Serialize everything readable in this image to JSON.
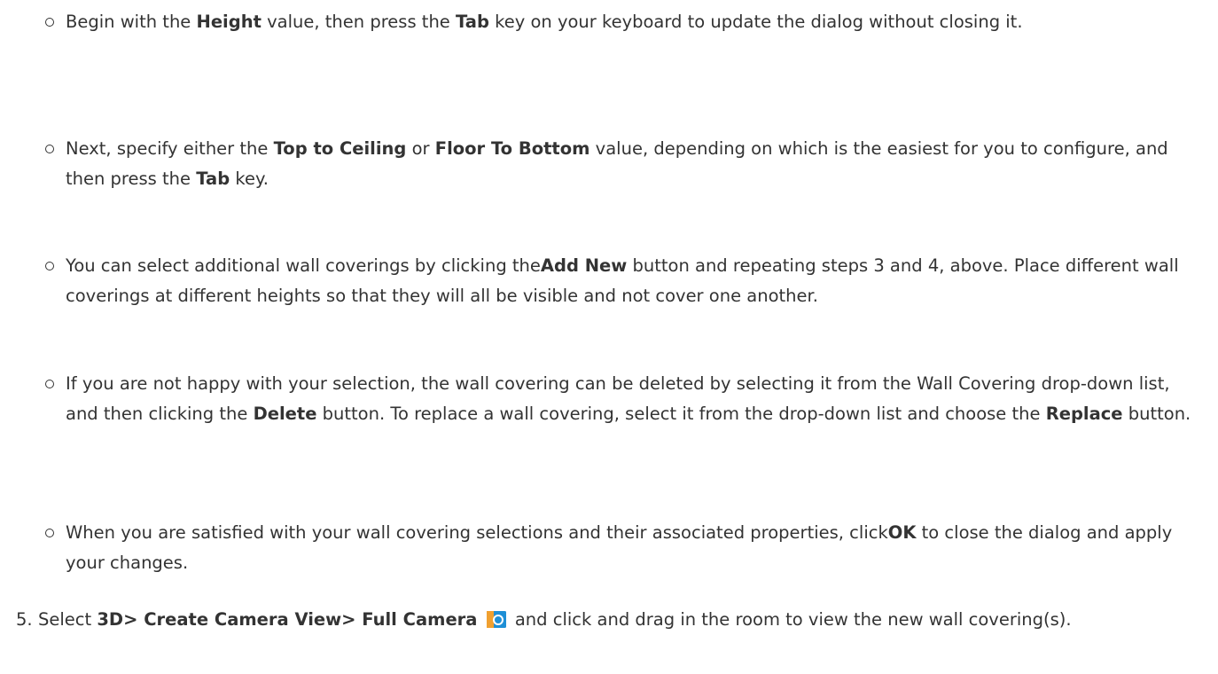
{
  "sub_steps": [
    {
      "t0": "Begin with the ",
      "b0": "Height",
      "t1": " value, then press the ",
      "b1": "Tab",
      "t2": " key on your keyboard to update the dialog without closing it."
    },
    {
      "t0": "Next, specify either the ",
      "b0": "Top to Ceiling",
      "t1": " or ",
      "b1": "Floor To Bottom",
      "t2": " value, depending on which is the easiest for you to configure, and then press the ",
      "b2": "Tab",
      "t3": " key."
    },
    {
      "t0": "You can select additional wall coverings by clicking the",
      "b0": "Add New",
      "t1": " button and repeating steps 3 and 4, above. Place different wall coverings at different heights so that they will all be visible and not cover one another."
    },
    {
      "t0": "If you are not happy with your selection, the wall covering can be deleted by selecting it from the Wall Covering drop-down list, and then clicking the ",
      "b0": "Delete",
      "t1": " button. To replace a wall covering, select it from the drop-down list and choose the ",
      "b1": "Replace",
      "t2": " button."
    },
    {
      "t0": "When you are satisfied with your wall covering selections and their associated properties, click",
      "b0": "OK",
      "t1": " to close the dialog and apply your changes."
    }
  ],
  "step5": {
    "number": "5.",
    "t0": "Select ",
    "b0": "3D> Create Camera View> Full Camera",
    "icon": "camera-icon",
    "t1": " and click and drag in the room to view the new wall covering(s)."
  },
  "colors": {
    "text": "#333333",
    "icon_blue": "#1e8fd6",
    "icon_orange": "#f0a030"
  }
}
